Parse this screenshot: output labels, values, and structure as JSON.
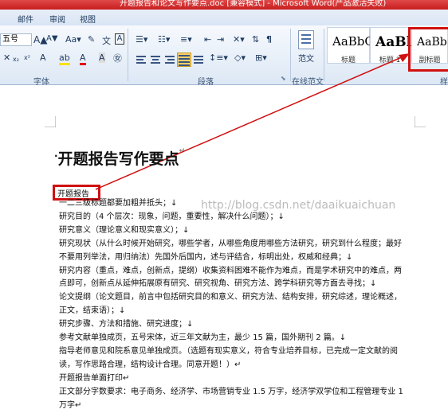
{
  "window": {
    "title": "开题报告和论文写作要点.doc [兼容模式] - Microsoft Word(产品激活失败)"
  },
  "tabs": [
    "邮件",
    "审阅",
    "视图"
  ],
  "ribbon": {
    "font_size": "五号",
    "groups": {
      "font": "字体",
      "paragraph": "段落",
      "no_cycle": "在线范文"
    },
    "fanwen": "范文",
    "styles": [
      {
        "sample": "AaBbC",
        "caption": "标题"
      },
      {
        "sample": "AaBl",
        "caption": "标题 1"
      },
      {
        "sample": "AaBbC",
        "caption": "副标题"
      }
    ]
  },
  "doc": {
    "heading": "开题报告写作要点",
    "subheading": "开题报告",
    "watermark": "http://blog.csdn.net/daaikuaichuan",
    "lines": [
      "一二三级标题都要加粗并抵头；↓",
      "研究目的（4 个层次：现象，问题，重要性，解决什么问题）；↓",
      "研究意义（理论意义和现实意义）；↓",
      "研究现状（从什么时候开始研究，哪些学者，从哪些角度用哪些方法研究，研究到什么程度；最好",
      "不要用列举法，用归纳法）先国外后国内，述与评结合，标明出处，权威和经典；↓",
      "研究内容（重点，难点，创新点，提纲）收集资料困难不能作为难点，而是学术研究中的难点，两",
      "点即可，创新点从延伸拓展原有研究、研究视角、研究方法、跨学科研究等方面去寻找；↓",
      "论文提纲（论文题目，前言中包括研究目的和意义、研究方法、结构安排，研究综述，理论概述，",
      "正文，结束语）；↓",
      "研究步骤、方法和措施、研究进度；↓",
      "参考文献单独成页，五号宋体，近三年文献为主，最少 15 篇，国外期刊 2 篇。↓",
      "指导老师意见和院系意见单独成页。（选题有现实意义，符合专业培养目标，已完成一定文献的阅",
      "读，写作思路合理，结构设计合理。同意开题！）↵",
      "开题报告单面打印↵",
      "正文部分字数要求：电子商务、经济学、市场营销专业 1.5 万字，经济学双学位和工程管理专业 1",
      "万字↵"
    ]
  }
}
